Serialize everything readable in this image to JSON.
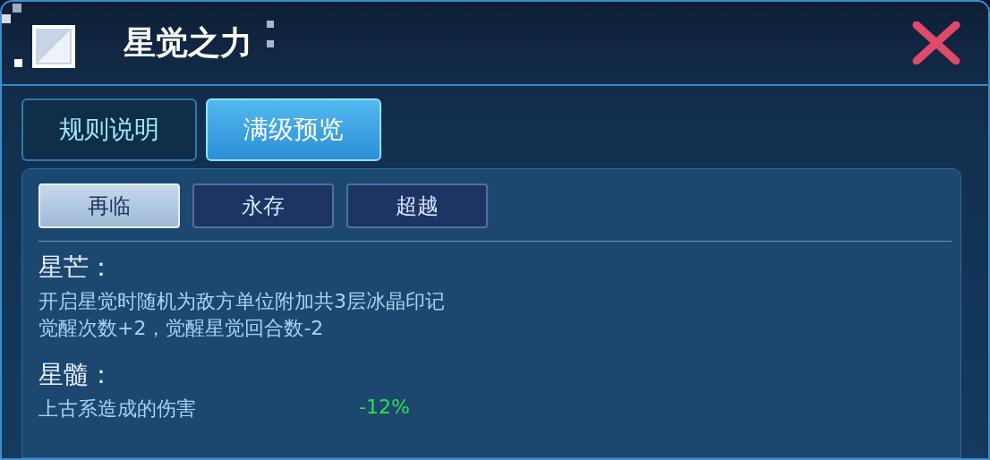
{
  "window": {
    "title": "星觉之力"
  },
  "tabs": [
    {
      "label": "规则说明",
      "selected": false
    },
    {
      "label": "满级预览",
      "selected": true
    }
  ],
  "sub_tabs": [
    {
      "label": "再临",
      "selected": true
    },
    {
      "label": "永存",
      "selected": false
    },
    {
      "label": "超越",
      "selected": false
    }
  ],
  "sections": [
    {
      "kind": "text",
      "heading": "星芒：",
      "lines": [
        "开启星觉时随机为敌方单位附加共3层冰晶印记",
        "觉醒次数+2，觉醒星觉回合数-2"
      ]
    },
    {
      "kind": "stats",
      "heading": "星髓：",
      "stats": [
        {
          "label": "上古系造成的伤害",
          "value": "-12%"
        }
      ]
    }
  ]
}
